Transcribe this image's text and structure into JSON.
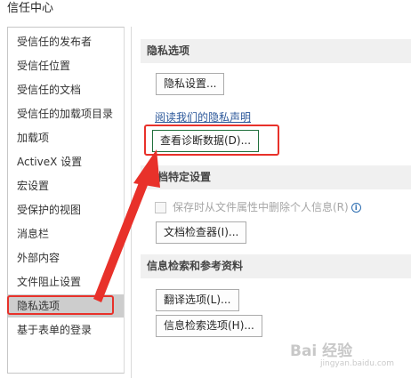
{
  "window": {
    "title": "信任中心"
  },
  "sidebar": {
    "items": [
      {
        "label": "受信任的发布者"
      },
      {
        "label": "受信任位置"
      },
      {
        "label": "受信任的文档"
      },
      {
        "label": "受信任的加载项目录"
      },
      {
        "label": "加载项"
      },
      {
        "label": "ActiveX 设置"
      },
      {
        "label": "宏设置"
      },
      {
        "label": "受保护的视图"
      },
      {
        "label": "消息栏"
      },
      {
        "label": "外部内容"
      },
      {
        "label": "文件阻止设置"
      },
      {
        "label": "隐私选项",
        "selected": true
      },
      {
        "label": "基于表单的登录"
      }
    ]
  },
  "privacy": {
    "heading": "隐私选项",
    "settings_button": "隐私设置...",
    "statement_link": "阅读我们的隐私声明",
    "diagnostics_button": "查看诊断数据(D)..."
  },
  "document_specific": {
    "heading": "文档特定设置",
    "remove_personal_info_checkbox": {
      "label": "保存时从文件属性中删除个人信息(R)",
      "checked": false,
      "enabled": false
    },
    "inspector_button": "文档检查器(I)..."
  },
  "research": {
    "heading": "信息检索和参考资料",
    "translation_button": "翻译选项(L)...",
    "research_button": "信息检索选项(H)..."
  },
  "annotation": {
    "highlight_color": "#e8312a"
  },
  "watermark": {
    "text": "Bai 经验",
    "subtext": "jingyan.baidu.com"
  },
  "icons": {
    "info": "info-icon",
    "checkbox": "checkbox-icon",
    "arrow": "arrow-annotation"
  }
}
